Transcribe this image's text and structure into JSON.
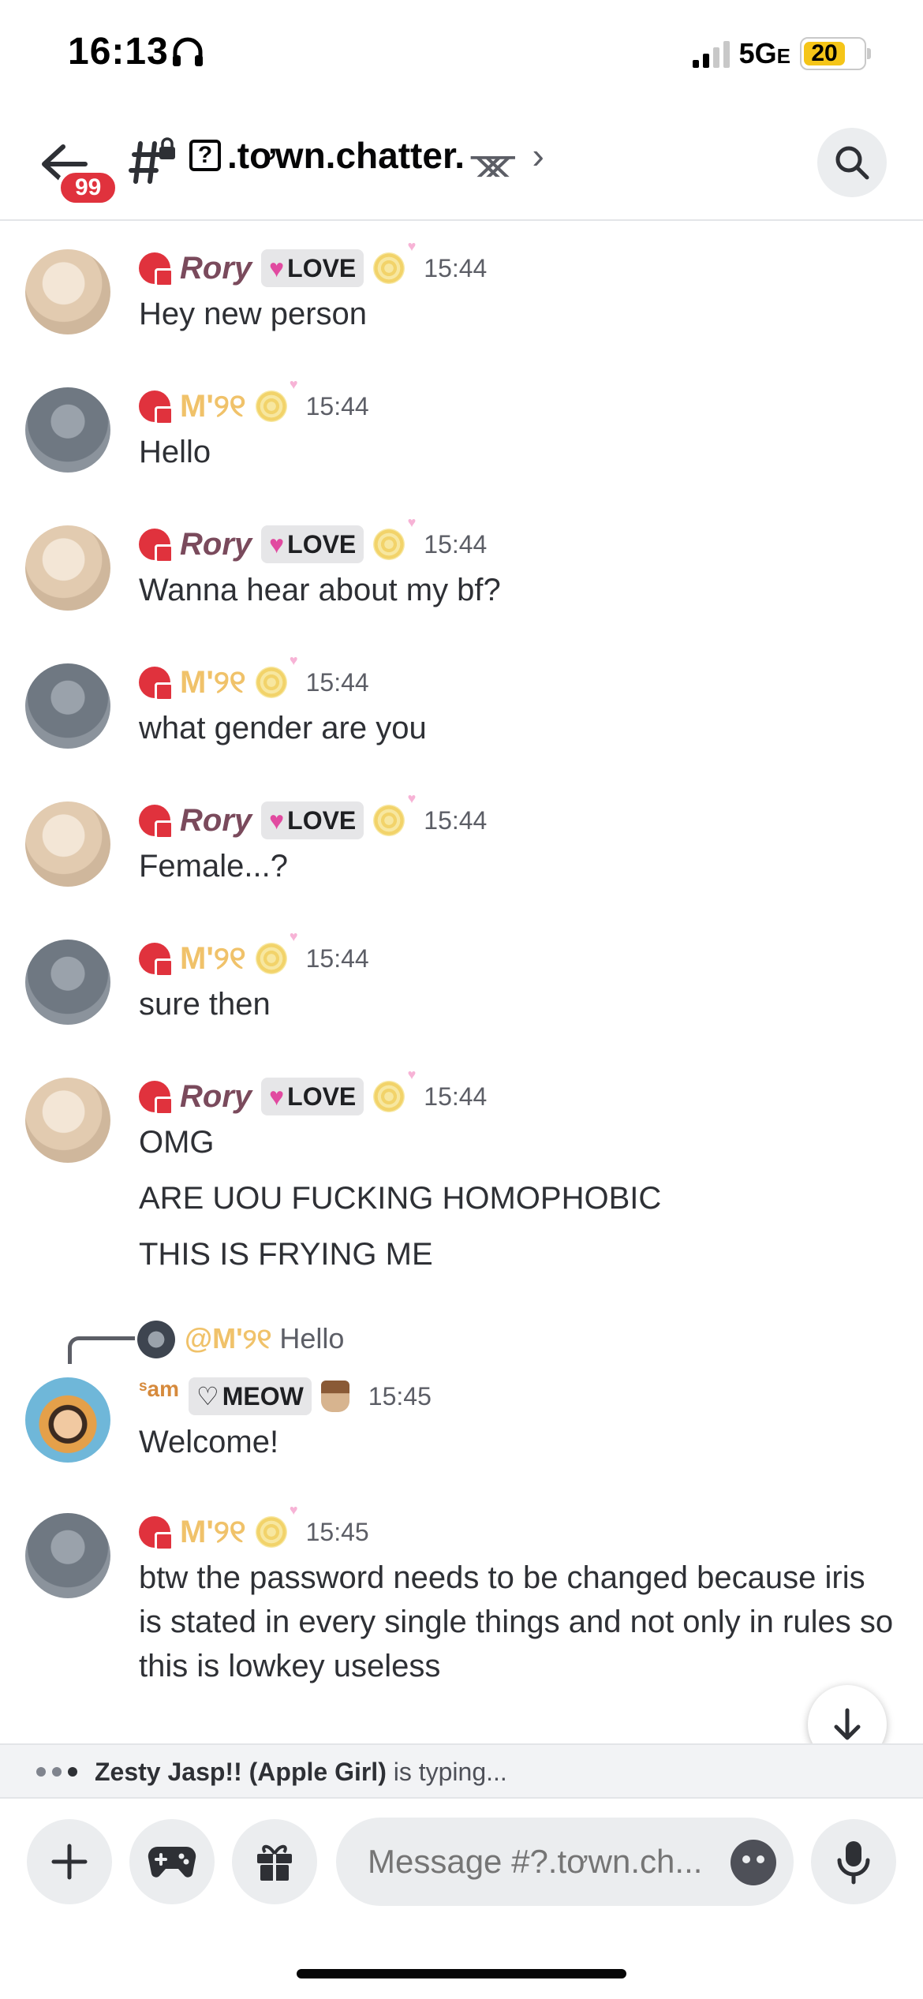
{
  "status_bar": {
    "time": "16:13",
    "network": "5G",
    "network_suffix": "E",
    "battery": "20"
  },
  "header": {
    "unread_badge": "99",
    "channel_prefix": "?",
    "channel_name": ".tơwn.chatter.",
    "channel_suffix": "ᚘ",
    "chevron": "›"
  },
  "messages": [
    {
      "author": "Rory",
      "tag": "LOVE",
      "time": "15:44",
      "lines": [
        "Hey new person"
      ]
    },
    {
      "author": "M'୨୧",
      "time": "15:44",
      "lines": [
        "Hello"
      ]
    },
    {
      "author": "Rory",
      "tag": "LOVE",
      "time": "15:44",
      "lines": [
        "Wanna hear about my bf?"
      ]
    },
    {
      "author": "M'୨୧",
      "time": "15:44",
      "lines": [
        "what gender are you"
      ]
    },
    {
      "author": "Rory",
      "tag": "LOVE",
      "time": "15:44",
      "lines": [
        "Female...?"
      ]
    },
    {
      "author": "M'୨୧",
      "time": "15:44",
      "lines": [
        "sure then"
      ]
    },
    {
      "author": "Rory",
      "tag": "LOVE",
      "time": "15:44",
      "lines": [
        "OMG",
        "ARE UOU FUCKING HOMOPHOBIC",
        "THIS IS FRYING ME"
      ]
    },
    {
      "reply": {
        "mention": "@M'୨୧",
        "text": "Hello"
      },
      "author": "ˢam",
      "tag": "MEOW",
      "time": "15:45",
      "lines": [
        "Welcome!"
      ]
    },
    {
      "author": "M'୨୧",
      "time": "15:45",
      "lines": [
        "btw the password needs to be changed because iris is stated in every single things and not only in rules so this is lowkey useless"
      ]
    }
  ],
  "typing": {
    "user": "Zesty Jasp!! (Apple Girl)",
    "suffix": "is typing..."
  },
  "composer": {
    "placeholder": "Message #?.tơwn.ch..."
  }
}
